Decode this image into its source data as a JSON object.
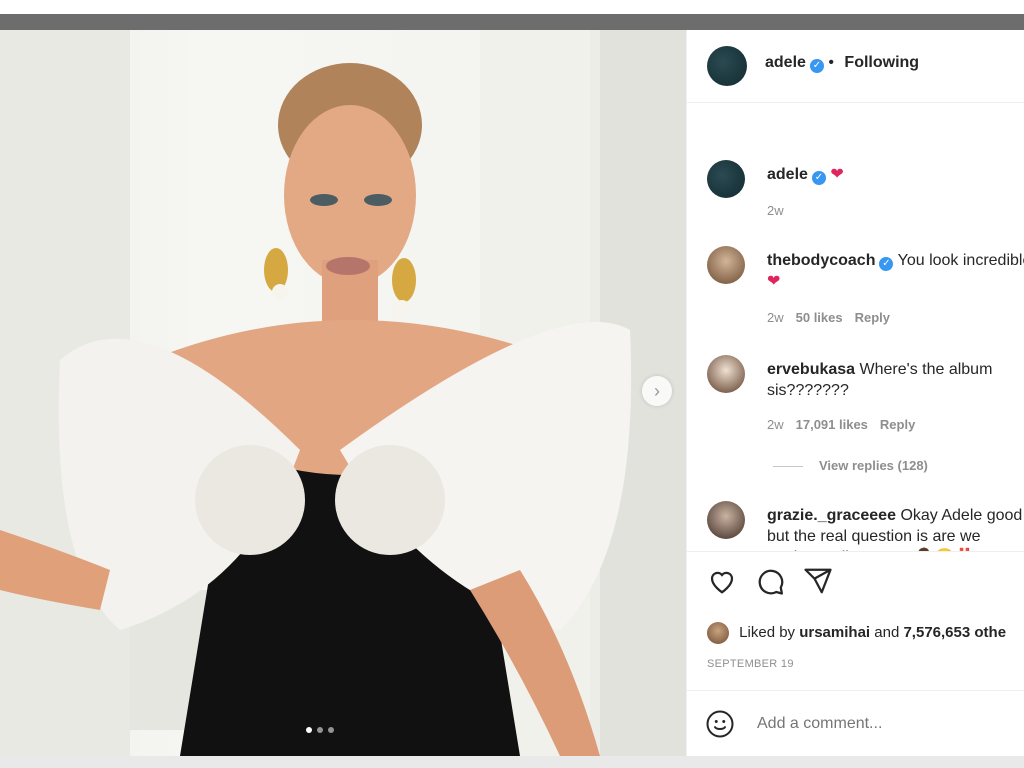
{
  "post": {
    "author": "adele",
    "following_label": "Following",
    "caption_time": "2w",
    "like_text_prefix": "Liked by",
    "liked_by_user": "ursamihai",
    "like_text_and": "and",
    "like_count": "7,576,653 othe",
    "date": "SEPTEMBER 19",
    "add_comment_placeholder": "Add a comment...",
    "carousel_count": 3,
    "carousel_active": 0
  },
  "comments": [
    {
      "user": "thebodycoach",
      "text": "You look incredible",
      "time": "2w",
      "likes": "50 likes",
      "reply": "Reply"
    },
    {
      "user": "ervebukasa",
      "text": "Where's the album sis???????",
      "time": "2w",
      "likes": "17,091 likes",
      "reply": "Reply",
      "view_replies": "View replies (128)"
    },
    {
      "user": "grazie._graceeee",
      "text": "Okay Adele good but the real question is are we getting a album now 🤷‍♀️😂‼️"
    }
  ],
  "colors": {
    "verified": "#3897f0",
    "heart": "#e0245e",
    "meta_text": "#8e8e8e"
  },
  "icons": [
    "verified-badge-icon",
    "heart-icon",
    "comment-icon",
    "share-icon",
    "emoji-icon",
    "chevron-right-icon"
  ]
}
